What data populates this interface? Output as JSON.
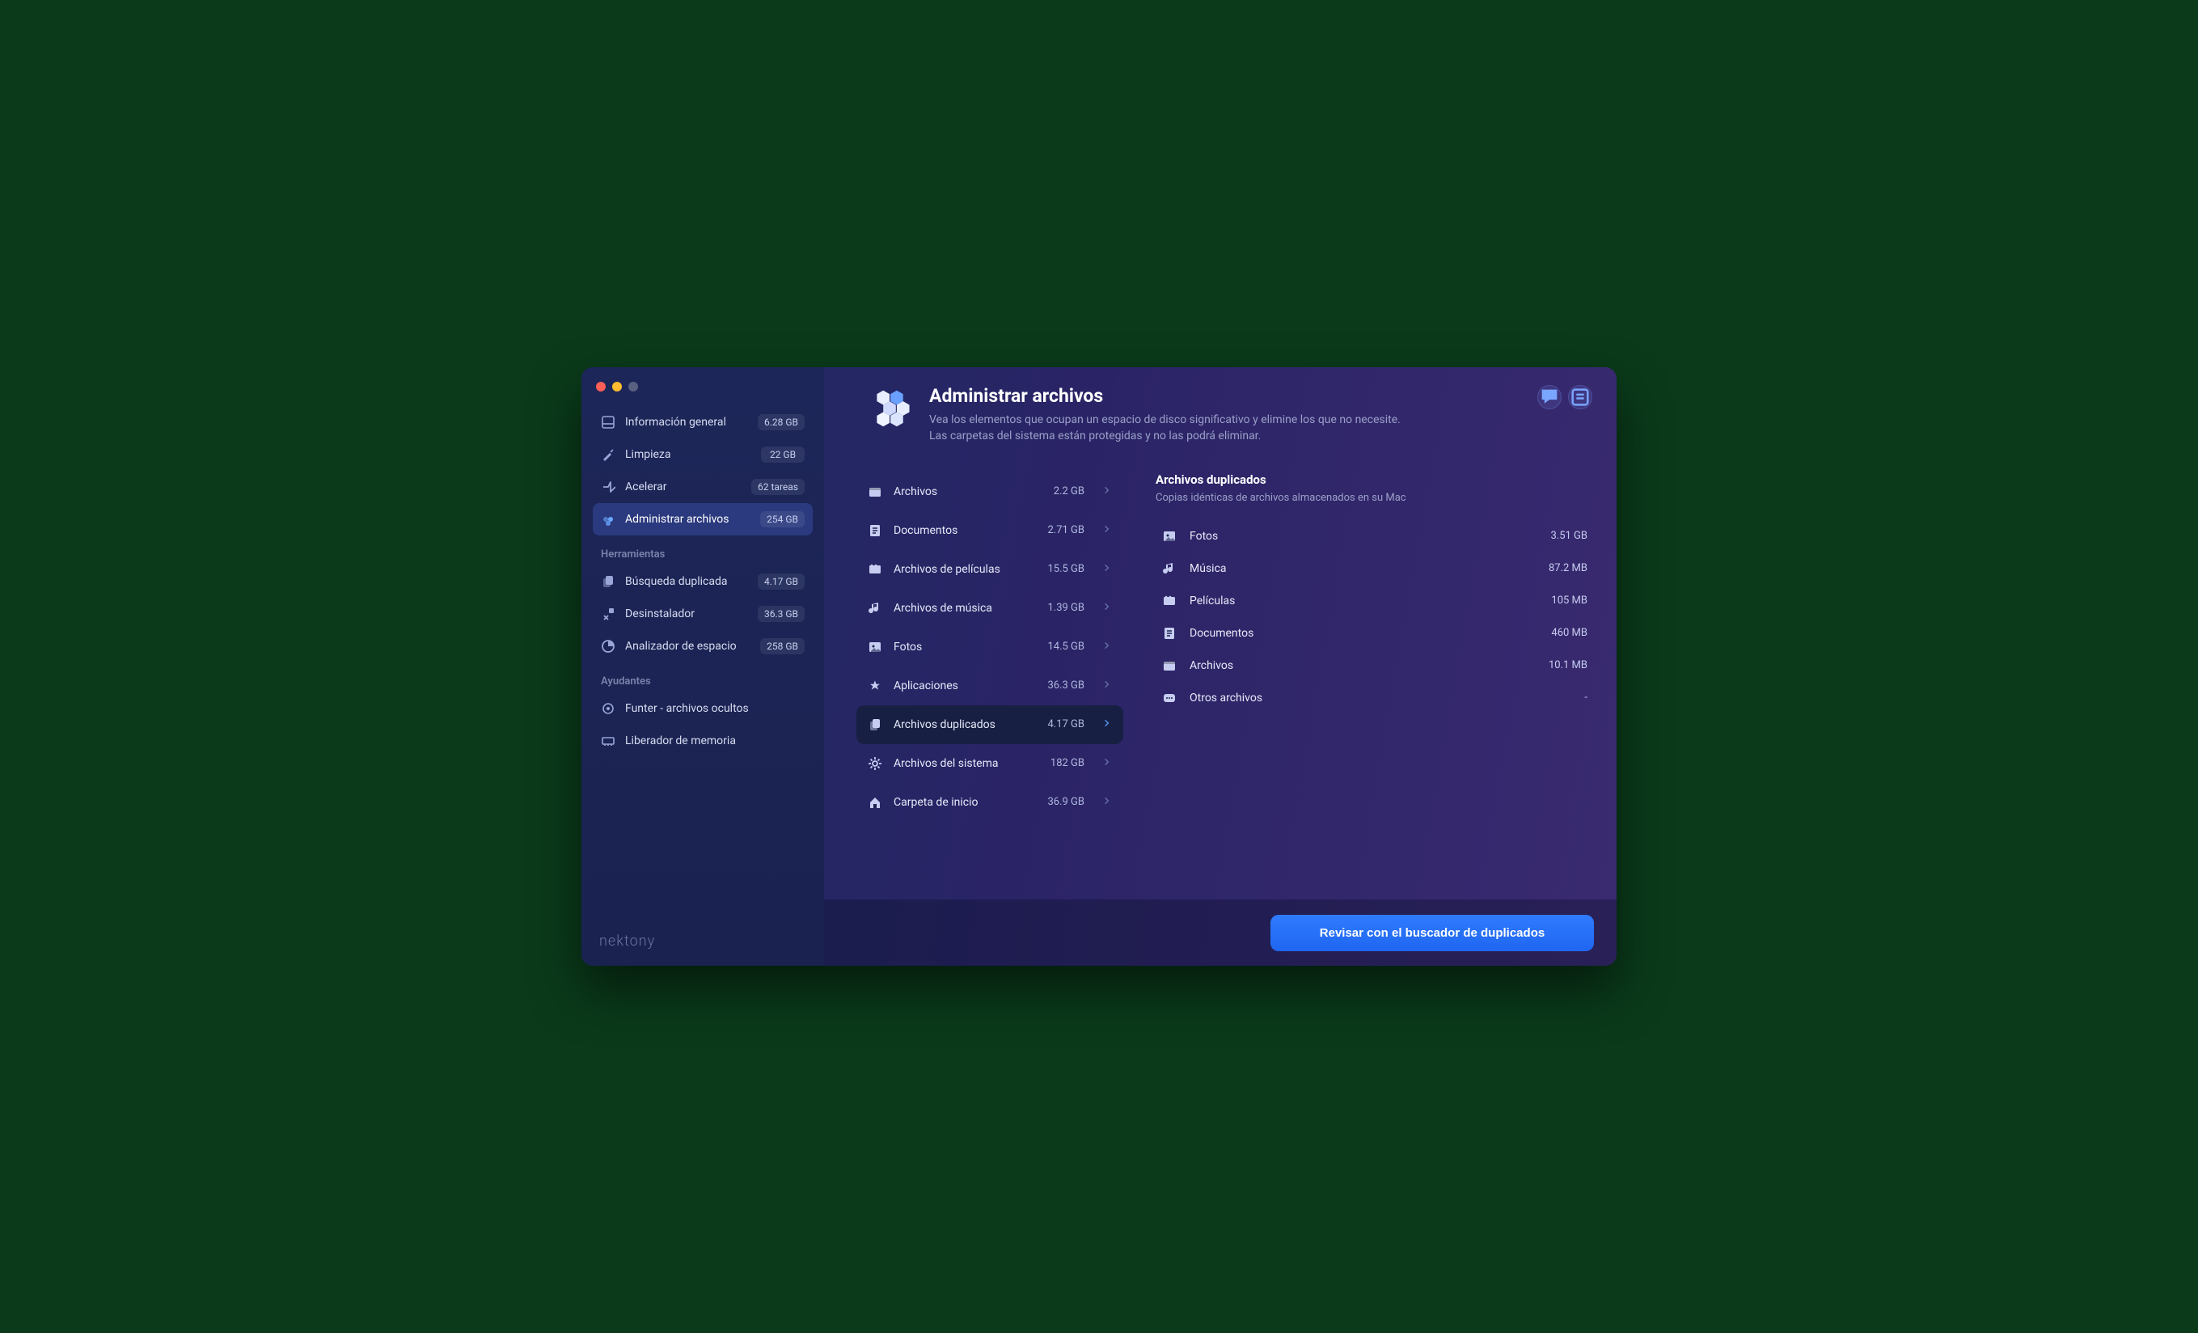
{
  "brand": "nektony",
  "header": {
    "title": "Administrar archivos",
    "desc_line1": "Vea los elementos que ocupan un espacio de disco significativo y elimine los que no necesite.",
    "desc_line2": "Las carpetas del sistema están protegidas y no las podrá eliminar."
  },
  "sidebar": {
    "main": [
      {
        "icon": "dashboard",
        "label": "Información general",
        "badge": "6.28 GB"
      },
      {
        "icon": "broom",
        "label": "Limpieza",
        "badge": "22 GB"
      },
      {
        "icon": "speed",
        "label": "Acelerar",
        "badge": "62 tareas"
      },
      {
        "icon": "hex",
        "label": "Administrar archivos",
        "badge": "254 GB",
        "active": true
      }
    ],
    "tools_header": "Herramientas",
    "tools": [
      {
        "icon": "dupe",
        "label": "Búsqueda duplicada",
        "badge": "4.17 GB"
      },
      {
        "icon": "uninst",
        "label": "Desinstalador",
        "badge": "36.3 GB"
      },
      {
        "icon": "disk",
        "label": "Analizador de espacio",
        "badge": "258 GB"
      }
    ],
    "helpers_header": "Ayudantes",
    "helpers": [
      {
        "icon": "target",
        "label": "Funter - archivos ocultos"
      },
      {
        "icon": "ram",
        "label": "Liberador de memoria"
      }
    ]
  },
  "categories": [
    {
      "icon": "archive",
      "label": "Archivos",
      "size": "2.2 GB"
    },
    {
      "icon": "doc",
      "label": "Documentos",
      "size": "2.71 GB"
    },
    {
      "icon": "movie",
      "label": "Archivos de películas",
      "size": "15.5 GB"
    },
    {
      "icon": "music",
      "label": "Archivos de música",
      "size": "1.39 GB"
    },
    {
      "icon": "photo",
      "label": "Fotos",
      "size": "14.5 GB"
    },
    {
      "icon": "app",
      "label": "Aplicaciones",
      "size": "36.3 GB"
    },
    {
      "icon": "dupe",
      "label": "Archivos duplicados",
      "size": "4.17 GB",
      "selected": true
    },
    {
      "icon": "gear",
      "label": "Archivos del sistema",
      "size": "182 GB"
    },
    {
      "icon": "home",
      "label": "Carpeta de inicio",
      "size": "36.9 GB"
    }
  ],
  "detail": {
    "title": "Archivos duplicados",
    "subtitle": "Copias idénticas de archivos almacenados en su Mac",
    "rows": [
      {
        "icon": "photo",
        "label": "Fotos",
        "size": "3.51 GB"
      },
      {
        "icon": "music",
        "label": "Música",
        "size": "87.2 MB"
      },
      {
        "icon": "movie",
        "label": "Películas",
        "size": "105 MB"
      },
      {
        "icon": "doc",
        "label": "Documentos",
        "size": "460 MB"
      },
      {
        "icon": "archive",
        "label": "Archivos",
        "size": "10.1 MB"
      },
      {
        "icon": "other",
        "label": "Otros archivos",
        "size": "-"
      }
    ]
  },
  "cta": "Revisar con el buscador de duplicados"
}
